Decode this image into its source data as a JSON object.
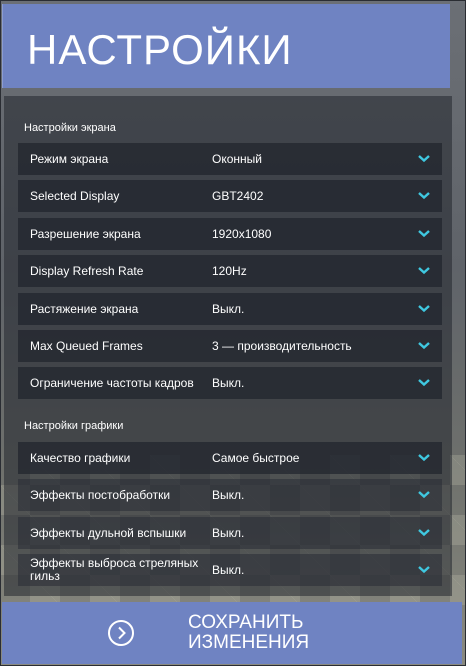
{
  "header": {
    "title": "НАСТРОЙКИ"
  },
  "sections": {
    "screen": {
      "label": "Настройки экрана",
      "rows": [
        {
          "label": "Режим экрана",
          "value": "Оконный"
        },
        {
          "label": "Selected Display",
          "value": "GBT2402"
        },
        {
          "label": "Разрешение экрана",
          "value": "1920x1080"
        },
        {
          "label": "Display Refresh Rate",
          "value": "120Hz"
        },
        {
          "label": "Растяжение экрана",
          "value": "Выкл."
        },
        {
          "label": "Max Queued Frames",
          "value": "3 — производительность"
        },
        {
          "label": "Ограничение частоты кадров",
          "value": "Выкл."
        }
      ]
    },
    "graphics": {
      "label": "Настройки графики",
      "rows": [
        {
          "label": "Качество графики",
          "value": "Самое быстрое"
        },
        {
          "label": "Эффекты постобработки",
          "value": "Выкл."
        },
        {
          "label": "Эффекты дульной вспышки",
          "value": "Выкл."
        },
        {
          "label": "Эффекты выброса стреляных гильз",
          "value": "Выкл."
        }
      ]
    }
  },
  "footer": {
    "save_line1": "СОХРАНИТЬ",
    "save_line2": "ИЗМЕНЕНИЯ"
  },
  "colors": {
    "accent": "#6f83c2",
    "chevron": "#3fc8e0"
  },
  "icons": {
    "dropdown": "chevron-down-icon",
    "save": "arrow-right-circle-icon"
  }
}
